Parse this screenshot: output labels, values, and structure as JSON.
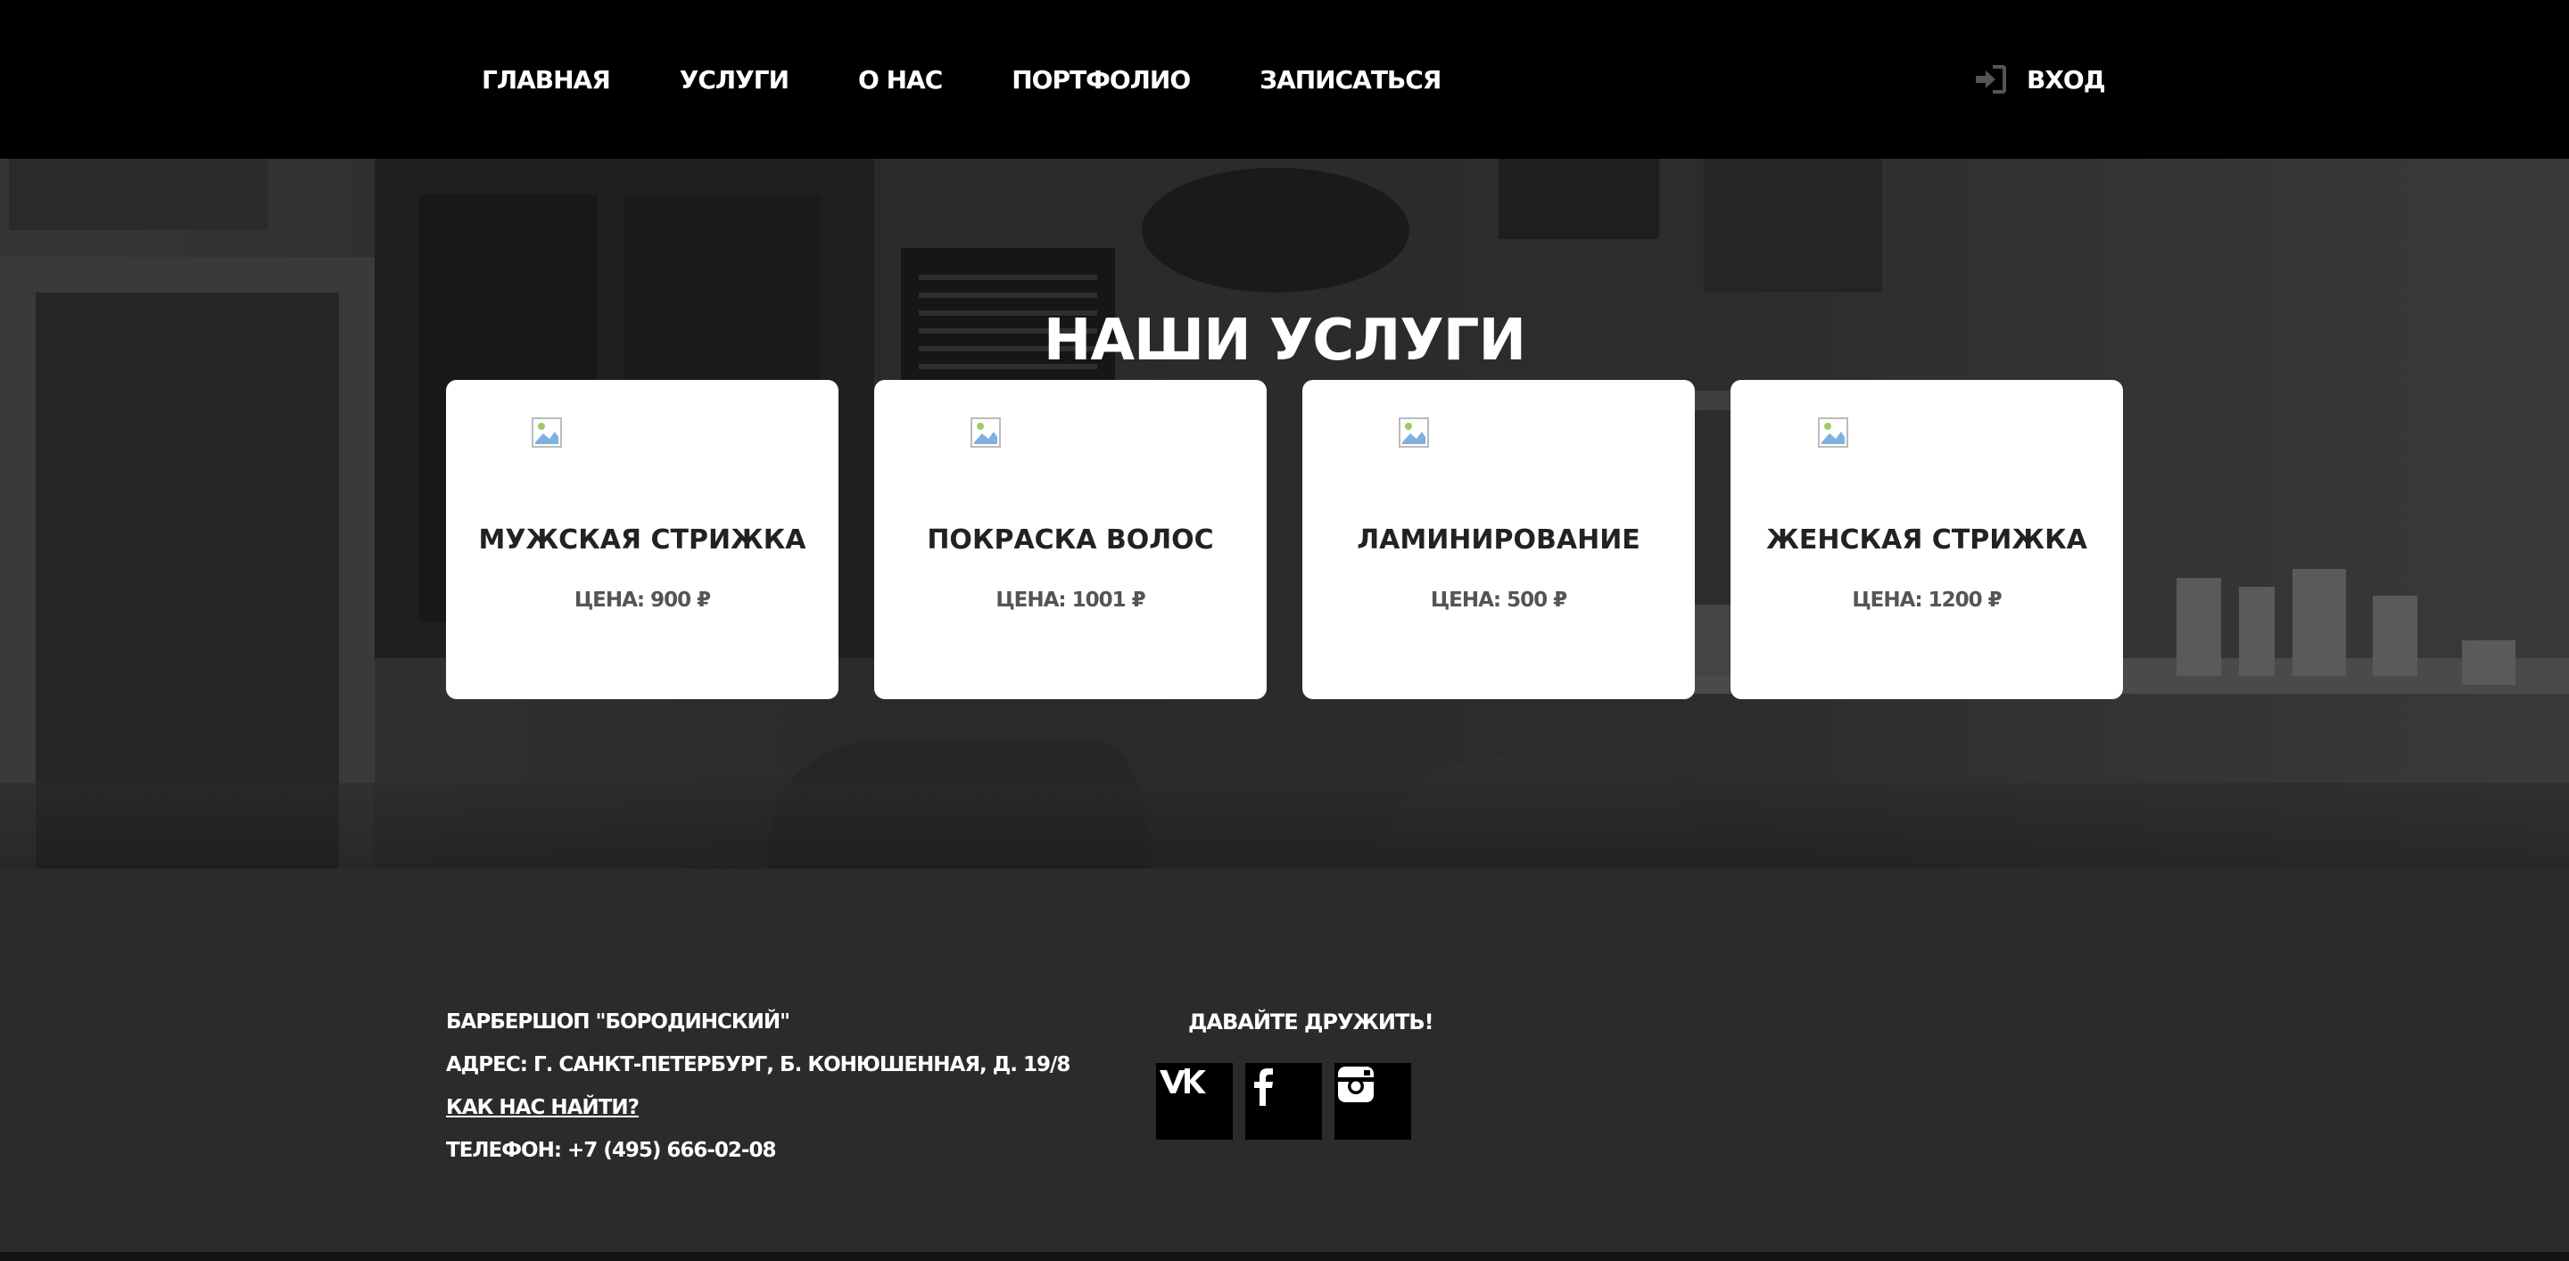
{
  "nav": {
    "items": [
      {
        "label": "ГЛАВНАЯ",
        "name": "nav-home"
      },
      {
        "label": "УСЛУГИ",
        "name": "nav-services"
      },
      {
        "label": "О НАС",
        "name": "nav-about"
      },
      {
        "label": "ПОРТФОЛИО",
        "name": "nav-portfolio"
      },
      {
        "label": "ЗАПИСАТЬСЯ",
        "name": "nav-booking"
      }
    ],
    "login": {
      "label": "ВХОД",
      "icon": "login-icon"
    }
  },
  "services": {
    "title": "НАШИ УСЛУГИ",
    "cards": [
      {
        "title": "МУЖСКАЯ СТРИЖКА",
        "price": "ЦЕНА: 900 ₽",
        "icon": "broken-image-icon"
      },
      {
        "title": "ПОКРАСКА ВОЛОС",
        "price": "ЦЕНА: 1001 ₽",
        "icon": "broken-image-icon"
      },
      {
        "title": "ЛАМИНИРОВАНИЕ",
        "price": "ЦЕНА: 500 ₽",
        "icon": "broken-image-icon"
      },
      {
        "title": "ЖЕНСКАЯ СТРИЖКА",
        "price": "ЦЕНА: 1200 ₽",
        "icon": "broken-image-icon"
      }
    ]
  },
  "footer": {
    "name": "БАРБЕРШОП \"БОРОДИНСКИЙ\"",
    "address": "АДРЕС: Г. САНКТ-ПЕТЕРБУРГ, Б. КОНЮШЕННАЯ, Д. 19/8",
    "find_link": "КАК НАС НАЙТИ?",
    "phone": "ТЕЛЕФОН: +7 (495) 666-02-08",
    "social_title": "ДАВАЙТЕ ДРУЖИТЬ!",
    "socials": [
      "vk-icon",
      "facebook-icon",
      "instagram-icon"
    ]
  },
  "colors": {
    "header_bg": "#000000",
    "card_bg": "#ffffff",
    "footer_bg": "#2b2b2b",
    "social_bg": "#000000"
  }
}
